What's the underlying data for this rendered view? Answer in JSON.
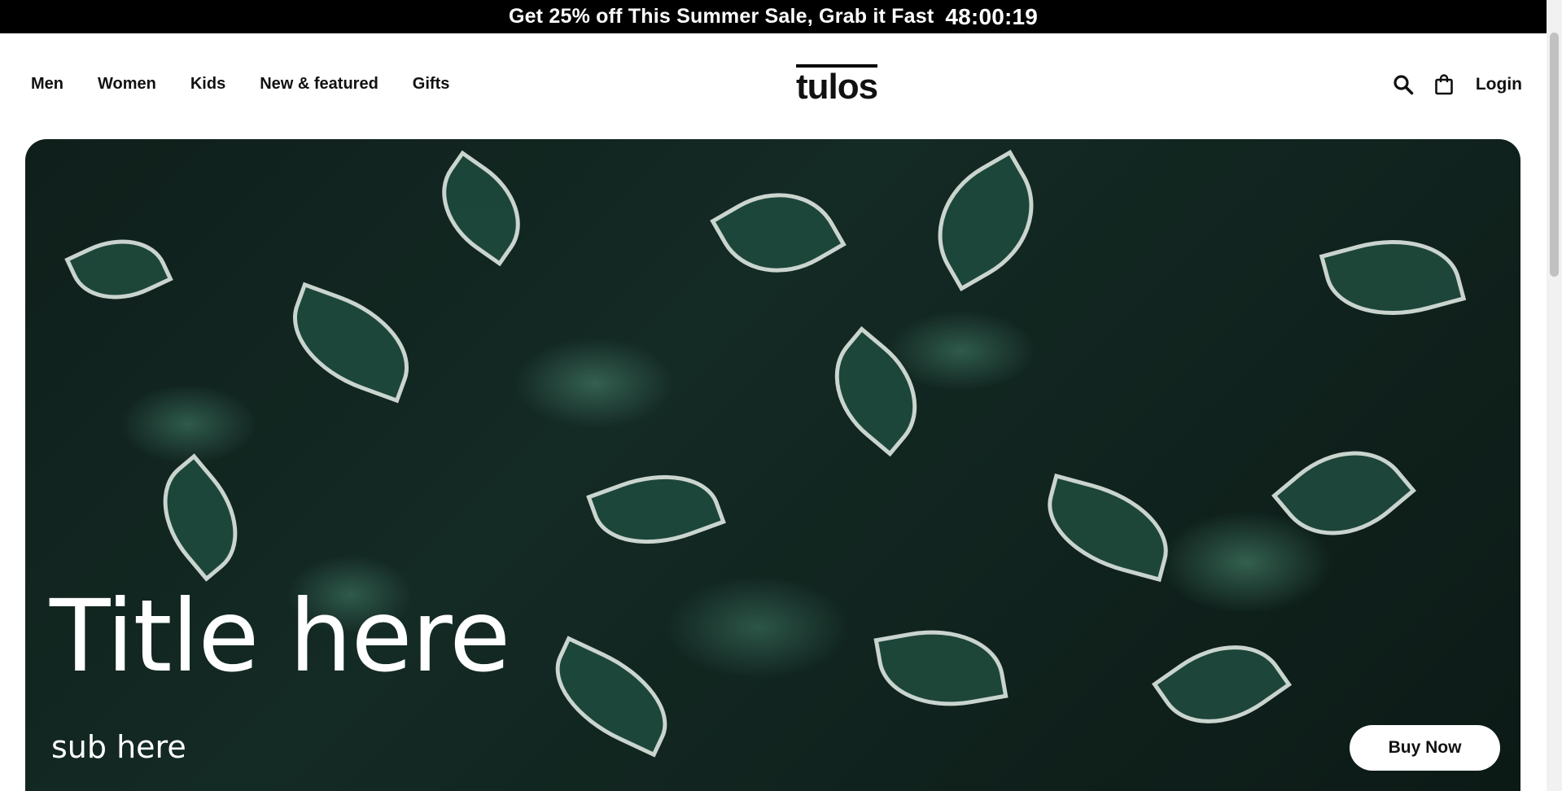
{
  "announcement": {
    "text": "Get 25% off This Summer Sale, Grab it Fast",
    "countdown": "48:00:19"
  },
  "nav": {
    "items": [
      {
        "label": "Men"
      },
      {
        "label": "Women"
      },
      {
        "label": "Kids"
      },
      {
        "label": "New & featured"
      },
      {
        "label": "Gifts"
      }
    ]
  },
  "logo": {
    "text": "tulos"
  },
  "header_actions": {
    "search_icon": "search-icon",
    "bag_icon": "shopping-bag-icon",
    "login_label": "Login"
  },
  "hero": {
    "title": "Title here",
    "subtitle": "sub here",
    "cta_label": "Buy Now",
    "background": "dark green variegated leaves photo"
  },
  "colors": {
    "announcement_bg": "#000000",
    "page_bg": "#ffffff",
    "hero_dark": "#0f1f1b",
    "leaf_green": "#1f4a3d",
    "leaf_edge": "#dfe8e2"
  }
}
